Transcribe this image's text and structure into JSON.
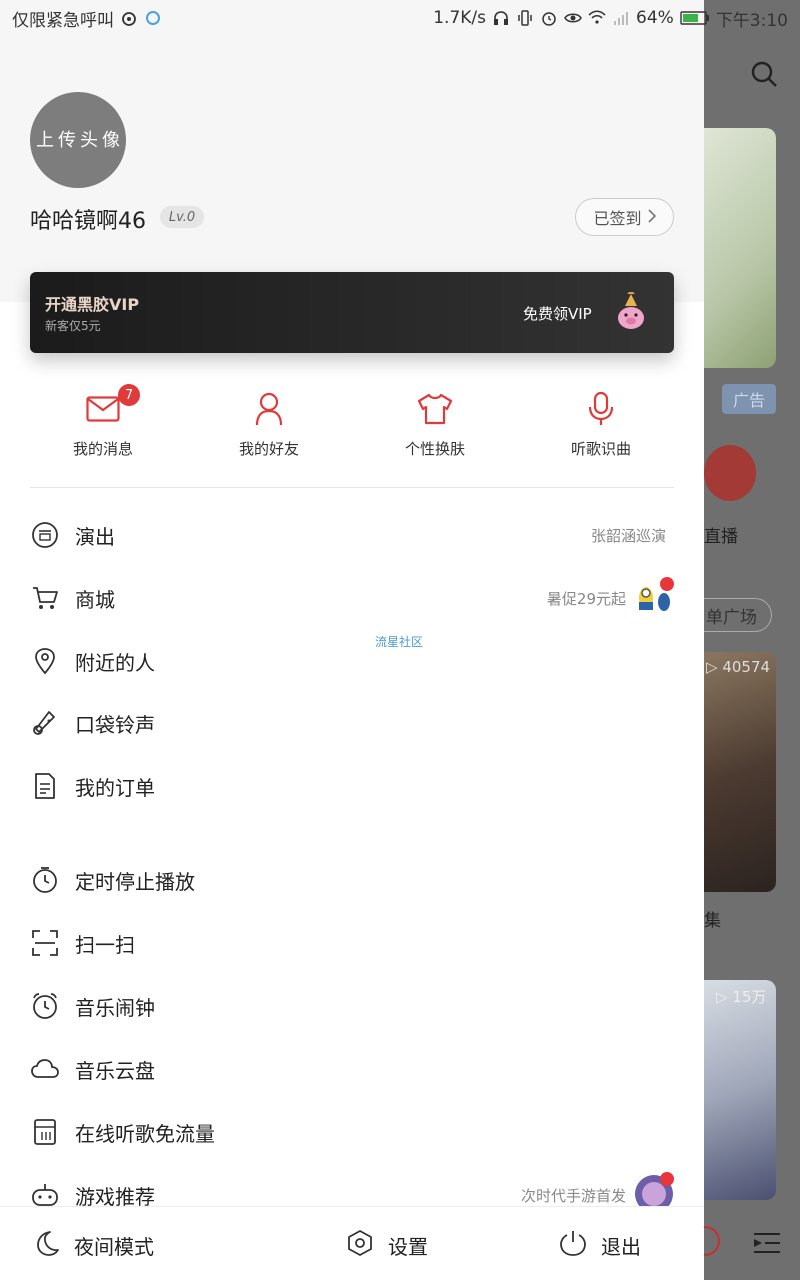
{
  "status_bar": {
    "left_text": "仅限紧急呼叫",
    "speed": "1.7K/s",
    "battery": "64%",
    "time": "下午3:10"
  },
  "profile": {
    "avatar_label": "上传头像",
    "username": "哈哈镜啊46",
    "level": "Lv.0",
    "signin_label": "已签到"
  },
  "vip": {
    "title": "开通黑胶VIP",
    "subtitle": "新客仅5元",
    "free_label": "免费领VIP"
  },
  "quick_actions": [
    {
      "label": "我的消息",
      "icon": "mail-icon",
      "badge": "7"
    },
    {
      "label": "我的好友",
      "icon": "user-icon"
    },
    {
      "label": "个性换肤",
      "icon": "shirt-icon"
    },
    {
      "label": "听歌识曲",
      "icon": "mic-icon"
    }
  ],
  "menu": [
    {
      "label": "演出",
      "icon": "ticket-icon",
      "right": "张韶涵巡演"
    },
    {
      "label": "商城",
      "icon": "cart-icon",
      "right": "暑促29元起"
    },
    {
      "label": "附近的人",
      "icon": "location-icon",
      "right": ""
    },
    {
      "label": "口袋铃声",
      "icon": "ringtone-icon",
      "right": ""
    },
    {
      "label": "我的订单",
      "icon": "order-icon",
      "right": ""
    },
    {
      "label": "定时停止播放",
      "icon": "timer-icon",
      "right": ""
    },
    {
      "label": "扫一扫",
      "icon": "scan-icon",
      "right": ""
    },
    {
      "label": "音乐闹钟",
      "icon": "alarm-icon",
      "right": ""
    },
    {
      "label": "音乐云盘",
      "icon": "cloud-icon",
      "right": ""
    },
    {
      "label": "在线听歌免流量",
      "icon": "sim-icon",
      "right": ""
    },
    {
      "label": "游戏推荐",
      "icon": "gamepad-icon",
      "right": "次时代手游首发"
    }
  ],
  "floating_tag": "流星社区",
  "bottom": {
    "night_mode": "夜间模式",
    "settings": "设置",
    "logout": "退出"
  },
  "background": {
    "ad_label": "广告",
    "live_label": "直播",
    "square_label": "单广场",
    "play_count_1": "40574",
    "play_count_2": "15万",
    "char_1": "集"
  },
  "colors": {
    "accent": "#e03a3a",
    "drawer_bg": "#ffffff",
    "header_bg": "#f6f6f6",
    "vip_bg": "#1b1b1b"
  }
}
